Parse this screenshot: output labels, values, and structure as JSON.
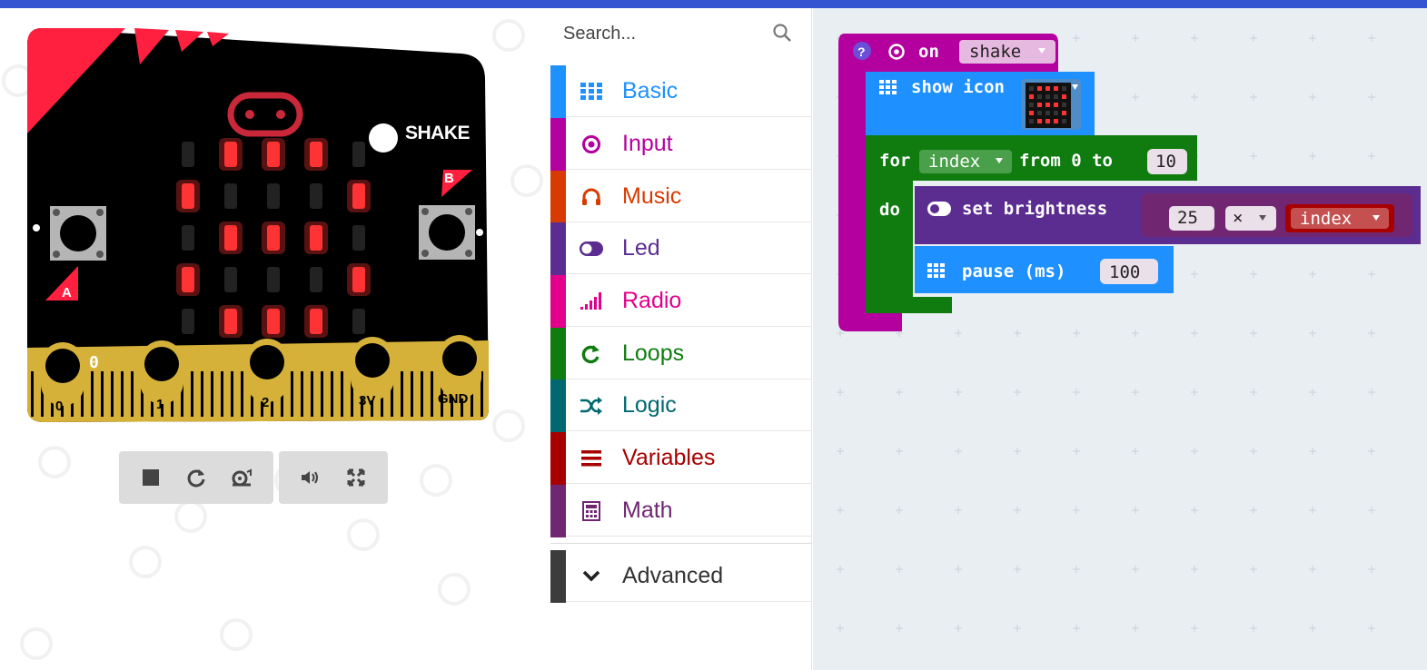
{
  "colors": {
    "topbar": "#3454d1",
    "input": "#b4009e",
    "basic": "#1e90ff",
    "loops": "#107c10",
    "led": "#5c2d91",
    "math": "#712672",
    "variables": "#a80000",
    "music": "#d83b01",
    "radio": "#e3008c",
    "logic": "#006970",
    "advanced": "#3c3c3c",
    "board": "#000000",
    "pins": "#d6b13a",
    "led_on": "#ff3333",
    "corner": "#ff2040"
  },
  "simulator": {
    "shake_label": "SHAKE",
    "button_a": "A",
    "button_b": "B",
    "pin_0": "0",
    "pin_1": "1",
    "pin_2": "2",
    "pin_3v": "3V",
    "pin_gnd": "GND",
    "pin0_reading": "0",
    "led_matrix": [
      [
        0,
        1,
        1,
        1,
        0
      ],
      [
        1,
        0,
        0,
        0,
        1
      ],
      [
        0,
        1,
        1,
        1,
        0
      ],
      [
        1,
        0,
        0,
        0,
        1
      ],
      [
        0,
        1,
        1,
        1,
        0
      ]
    ],
    "toolbar": {
      "group1": [
        "stop-icon",
        "restart-icon",
        "slowmo-icon"
      ],
      "group2": [
        "mute-icon",
        "fullscreen-icon"
      ]
    }
  },
  "toolbox": {
    "search_placeholder": "Search...",
    "categories": [
      {
        "label": "Basic",
        "color": "#1e90ff",
        "icon": "grid-icon"
      },
      {
        "label": "Input",
        "color": "#b4009e",
        "icon": "target-icon"
      },
      {
        "label": "Music",
        "color": "#d83b01",
        "icon": "headphones-icon"
      },
      {
        "label": "Led",
        "color": "#5c2d91",
        "icon": "toggle-icon"
      },
      {
        "label": "Radio",
        "color": "#e3008c",
        "icon": "signal-icon"
      },
      {
        "label": "Loops",
        "color": "#107c10",
        "icon": "refresh-icon"
      },
      {
        "label": "Logic",
        "color": "#006970",
        "icon": "shuffle-icon"
      },
      {
        "label": "Variables",
        "color": "#a80000",
        "icon": "list-icon"
      },
      {
        "label": "Math",
        "color": "#712672",
        "icon": "calculator-icon"
      }
    ],
    "advanced": {
      "label": "Advanced",
      "icon": "chevron-down-icon"
    }
  },
  "blocks": {
    "event": {
      "help": "?",
      "on": "on",
      "event": "shake"
    },
    "show_icon": {
      "label": "show icon"
    },
    "for": {
      "for": "for",
      "var": "index",
      "from": "from 0 to",
      "to": "10",
      "do": "do"
    },
    "brightness": {
      "label": "set brightness",
      "left": "25",
      "op": "×",
      "var": "index"
    },
    "pause": {
      "label": "pause (ms)",
      "value": "100"
    }
  }
}
